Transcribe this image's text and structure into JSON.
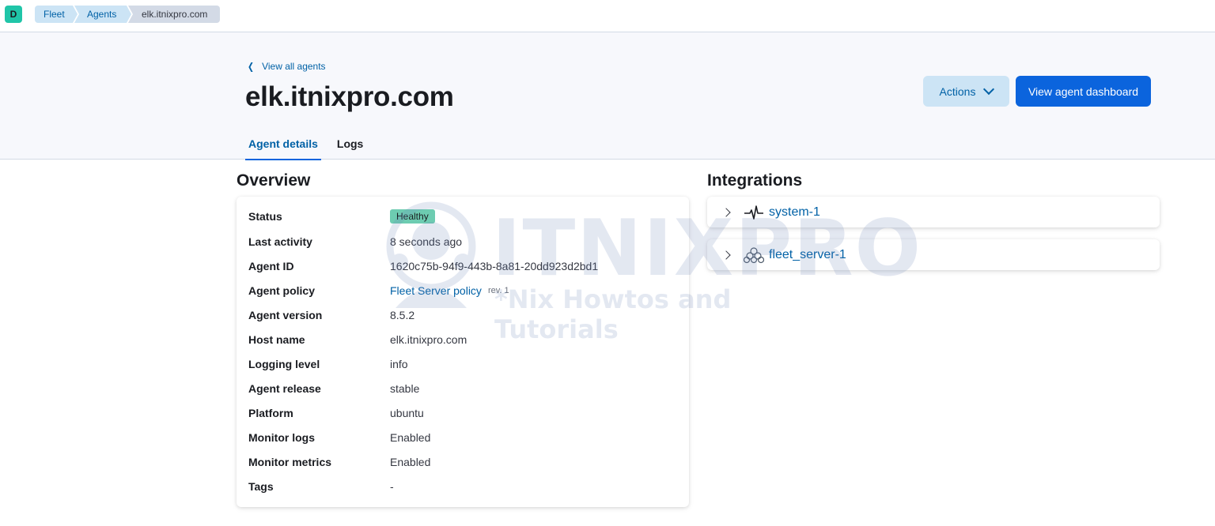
{
  "topbar": {
    "space_initial": "D",
    "breadcrumbs": [
      "Fleet",
      "Agents",
      "elk.itnixpro.com"
    ]
  },
  "header": {
    "back_link": "View all agents",
    "title": "elk.itnixpro.com",
    "actions_label": "Actions",
    "dashboard_label": "View agent dashboard",
    "tabs": [
      {
        "label": "Agent details",
        "active": true
      },
      {
        "label": "Logs",
        "active": false
      }
    ]
  },
  "overview": {
    "title": "Overview",
    "rows": [
      {
        "label": "Status",
        "value": "Healthy"
      },
      {
        "label": "Last activity",
        "value": "8 seconds ago"
      },
      {
        "label": "Agent ID",
        "value": "1620c75b-94f9-443b-8a81-20dd923d2bd1"
      },
      {
        "label": "Agent policy",
        "value": "Fleet Server policy",
        "extra": "rev. 1"
      },
      {
        "label": "Agent version",
        "value": "8.5.2"
      },
      {
        "label": "Host name",
        "value": "elk.itnixpro.com"
      },
      {
        "label": "Logging level",
        "value": "info"
      },
      {
        "label": "Agent release",
        "value": "stable"
      },
      {
        "label": "Platform",
        "value": "ubuntu"
      },
      {
        "label": "Monitor logs",
        "value": "Enabled"
      },
      {
        "label": "Monitor metrics",
        "value": "Enabled"
      },
      {
        "label": "Tags",
        "value": "-"
      }
    ]
  },
  "integrations": {
    "title": "Integrations",
    "items": [
      {
        "name": "system-1",
        "icon": "pulse-icon"
      },
      {
        "name": "fleet_server-1",
        "icon": "fleet-server-icon"
      }
    ]
  },
  "watermark": {
    "word": "ITNIXPRO",
    "tagline": "*Nix Howtos and Tutorials"
  },
  "colors": {
    "accent": "#0b64dd",
    "link": "#0061a6",
    "healthy": "#6dccb1",
    "space_avatar": "#20c5a8"
  }
}
